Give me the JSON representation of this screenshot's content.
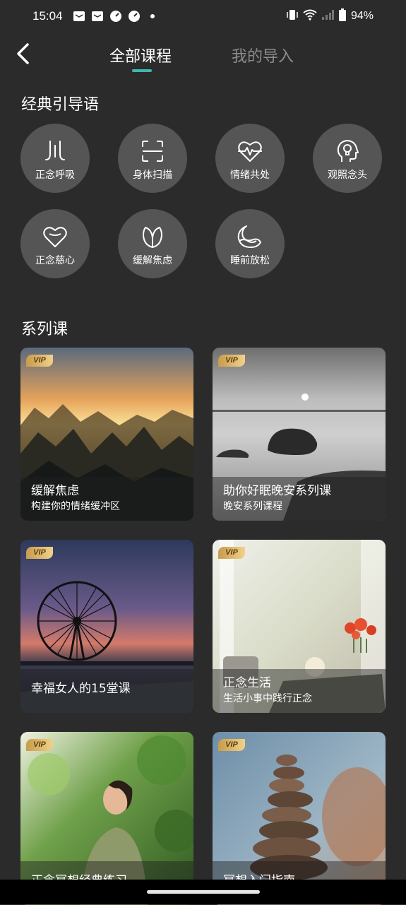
{
  "status_bar": {
    "time": "15:04",
    "notification_icons": [
      "mail-icon",
      "mail-icon",
      "speedometer-icon",
      "speedometer-icon",
      "dot-icon"
    ],
    "battery": "94%"
  },
  "header": {
    "tabs": [
      {
        "label": "全部课程",
        "active": true
      },
      {
        "label": "我的导入",
        "active": false
      }
    ],
    "accent_color": "#3fb8b0"
  },
  "guides": {
    "title": "经典引导语",
    "items": [
      {
        "label": "正念呼吸",
        "icon": "breath-icon"
      },
      {
        "label": "身体扫描",
        "icon": "scan-icon"
      },
      {
        "label": "情绪共处",
        "icon": "heartbeat-icon"
      },
      {
        "label": "观照念头",
        "icon": "mind-bulb-icon"
      },
      {
        "label": "正念慈心",
        "icon": "heart-icon"
      },
      {
        "label": "缓解焦虑",
        "icon": "leaf-icon"
      },
      {
        "label": "睡前放松",
        "icon": "moon-icon"
      }
    ]
  },
  "series": {
    "title": "系列课",
    "cards": [
      {
        "badge": "VIP",
        "title": "缓解焦虑",
        "subtitle": "构建你的情绪缓冲区"
      },
      {
        "badge": "VIP",
        "title": "助你好眠晚安系列课",
        "subtitle": "晚安系列课程"
      },
      {
        "badge": "VIP",
        "title": "幸福女人的15堂课",
        "subtitle": ""
      },
      {
        "badge": "VIP",
        "title": "正念生活",
        "subtitle": "生活小事中践行正念"
      },
      {
        "badge": "VIP",
        "title": "正念冥想经典练习",
        "subtitle": ""
      },
      {
        "badge": "VIP",
        "title": "冥想入门指南",
        "subtitle": ""
      }
    ]
  }
}
